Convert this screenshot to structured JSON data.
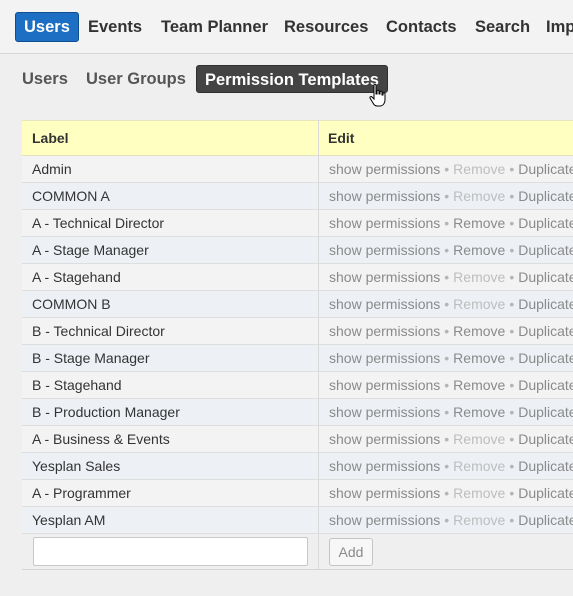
{
  "topnav": {
    "items": [
      {
        "label": "Users",
        "active": true
      },
      {
        "label": "Events"
      },
      {
        "label": "Team Planner"
      },
      {
        "label": "Resources"
      },
      {
        "label": "Contacts"
      },
      {
        "label": "Search"
      },
      {
        "label": "Imp"
      }
    ]
  },
  "subnav": {
    "items": [
      {
        "label": "Users"
      },
      {
        "label": "User Groups"
      },
      {
        "label": "Permission Templates",
        "active": true
      }
    ]
  },
  "table": {
    "headers": {
      "label": "Label",
      "edit": "Edit"
    },
    "actions": {
      "show": "show permissions",
      "remove": "Remove",
      "duplicate": "Duplicate",
      "separator": "•"
    },
    "rows": [
      {
        "label": "Admin",
        "remove_enabled": false
      },
      {
        "label": "COMMON A",
        "remove_enabled": false
      },
      {
        "label": "A - Technical Director",
        "remove_enabled": true
      },
      {
        "label": "A - Stage Manager",
        "remove_enabled": true
      },
      {
        "label": "A - Stagehand",
        "remove_enabled": false
      },
      {
        "label": "COMMON B",
        "remove_enabled": false
      },
      {
        "label": "B - Technical Director",
        "remove_enabled": true
      },
      {
        "label": "B - Stage Manager",
        "remove_enabled": true
      },
      {
        "label": "B - Stagehand",
        "remove_enabled": true
      },
      {
        "label": "B - Production Manager",
        "remove_enabled": true
      },
      {
        "label": "A - Business & Events",
        "remove_enabled": false
      },
      {
        "label": "Yesplan Sales",
        "remove_enabled": false
      },
      {
        "label": "A - Programmer",
        "remove_enabled": false
      },
      {
        "label": "Yesplan AM",
        "remove_enabled": false
      }
    ],
    "new_label_value": "",
    "add_label": "Add"
  },
  "colors": {
    "accent": "#1c6fc2",
    "header_bg": "#ffffc2",
    "active_subtab": "#444444"
  }
}
